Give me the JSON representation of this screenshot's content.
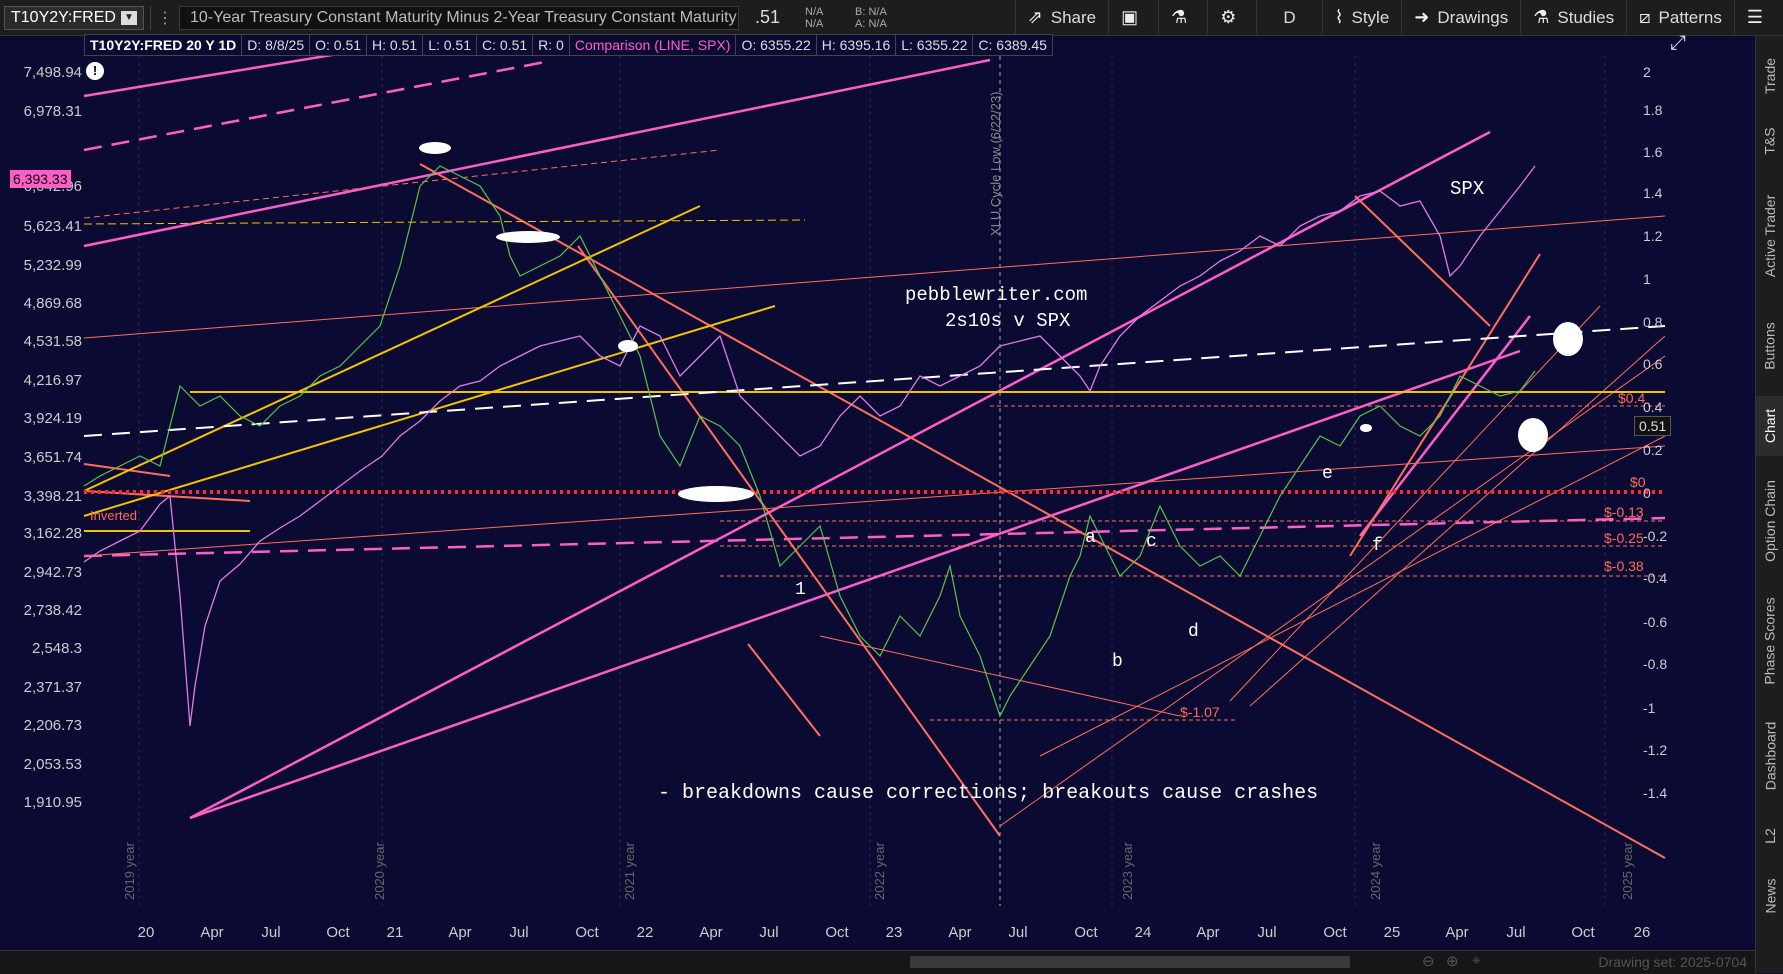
{
  "toolbar": {
    "symbol": "T10Y2Y:FRED",
    "description": "10-Year Treasury Constant Maturity Minus 2-Year Treasury Constant Maturity",
    "last": ".51",
    "na1": "N/A",
    "na2": "N/A",
    "bid": "B: N/A",
    "ask": "A: N/A",
    "share": "Share",
    "period": "D",
    "style": "Style",
    "drawings": "Drawings",
    "studies": "Studies",
    "patterns": "Patterns"
  },
  "header": {
    "symbol": "T10Y2Y:FRED 20 Y 1D",
    "date": "D: 8/8/25",
    "open": "O: 0.51",
    "high": "H: 0.51",
    "low": "L: 0.51",
    "close": "C: 0.51",
    "r": "R: 0",
    "comparison": "Comparison (LINE, SPX)",
    "c_open": "O: 6355.22",
    "c_high": "H: 6395.16",
    "c_low": "L: 6355.22",
    "c_close": "C: 6389.45"
  },
  "left_axis": [
    "7,498.94",
    "6,978.31",
    "6,042.96",
    "5,623.41",
    "5,232.99",
    "4,869.68",
    "4,531.58",
    "4,216.97",
    "3,924.19",
    "3,651.74",
    "3,398.21",
    "3,162.28",
    "2,942.73",
    "2,738.42",
    "2,548.3",
    "2,371.37",
    "2,206.73",
    "2,053.53",
    "1,910.95"
  ],
  "price_badge": "6,393.33",
  "right_axis": [
    "2",
    "1.8",
    "1.6",
    "1.4",
    "1.2",
    "1",
    "0.8",
    "0.6",
    "0.4",
    "0.2",
    "0",
    "-0.2",
    "-0.4",
    "-0.6",
    "-0.8",
    "-1",
    "-1.2",
    "-1.4"
  ],
  "value_badge": "0.51",
  "x_axis": [
    "20",
    "Apr",
    "Jul",
    "Oct",
    "21",
    "Apr",
    "Jul",
    "Oct",
    "22",
    "Apr",
    "Jul",
    "Oct",
    "23",
    "Apr",
    "Jul",
    "Oct",
    "24",
    "Apr",
    "Jul",
    "Oct",
    "25",
    "Apr",
    "Jul",
    "Oct",
    "26"
  ],
  "year_labels": [
    "2019 year",
    "2020 year",
    "2021 year",
    "2022 year",
    "2023 year",
    "2024 year",
    "2025 year"
  ],
  "cycle_label": "XLU Cycle Low (6/22/23)",
  "annotations": {
    "site": "pebblewriter.com",
    "subtitle": "2s10s v SPX",
    "spx": "SPX",
    "footer": "- breakdowns cause corrections; breakouts cause crashes",
    "inverted": "Inverted",
    "waves": [
      "a",
      "b",
      "c",
      "d",
      "e",
      "f",
      "1"
    ]
  },
  "levels": [
    "$0.4",
    "$0",
    "$-0.13",
    "$-0.25",
    "$-0.38",
    "$-1.07"
  ],
  "side_tabs": [
    "Trade",
    "T&S",
    "Active Trader",
    "Buttons",
    "Chart",
    "Option Chain",
    "Phase Scores",
    "Dashboard",
    "L2",
    "News"
  ],
  "drawing_set": "Drawing set: 2025-0704",
  "colors": {
    "bg": "#0a0a32",
    "spx": "#e07be8",
    "yield": "#57c34a",
    "trend_pink": "#ff5ec8",
    "trend_orange": "#ff7a5a",
    "trend_yellow": "#f2c300"
  }
}
